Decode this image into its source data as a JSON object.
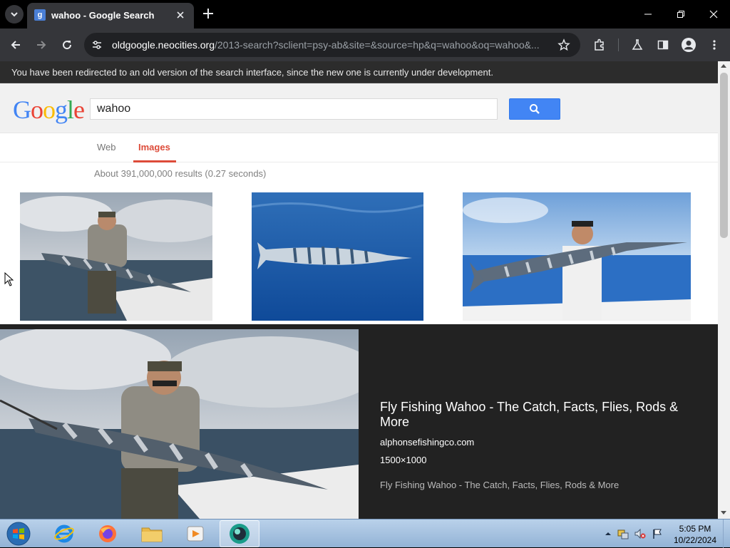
{
  "browser": {
    "tab_title": "wahoo - Google Search",
    "favicon_letter": "g",
    "url_host": "oldgoogle.neocities.org",
    "url_path": "/2013-search?sclient=psy-ab&site=&source=hp&q=wahoo&oq=wahoo&..."
  },
  "redirect_notice": "You have been redirected to an old version of the search interface, since the new one is currently under development.",
  "search": {
    "logo_letters": [
      "G",
      "o",
      "o",
      "g",
      "l",
      "e"
    ],
    "logo_colors": [
      "#4285f4",
      "#ea4335",
      "#fbbc05",
      "#4285f4",
      "#34a853",
      "#ea4335"
    ],
    "query": "wahoo"
  },
  "tabs": {
    "web": "Web",
    "images": "Images"
  },
  "result_stats": "About 391,000,000 results (0.27 seconds)",
  "image_results": [
    {
      "alt": "Angler on boat holding wahoo"
    },
    {
      "alt": "Wahoo swimming underwater"
    },
    {
      "alt": "Man on boat holding wahoo"
    }
  ],
  "preview": {
    "title": "Fly Fishing Wahoo - The Catch, Facts, Flies, Rods & More",
    "domain": "alphonsefishingco.com",
    "size": "1500×1000",
    "description": "Fly Fishing Wahoo - The Catch, Facts, Flies, Rods & More"
  },
  "taskbar": {
    "apps": [
      "internet-explorer",
      "firefox",
      "file-explorer",
      "media-player",
      "chromium-app"
    ],
    "time": "5:05 PM",
    "date": "10/22/2024"
  }
}
